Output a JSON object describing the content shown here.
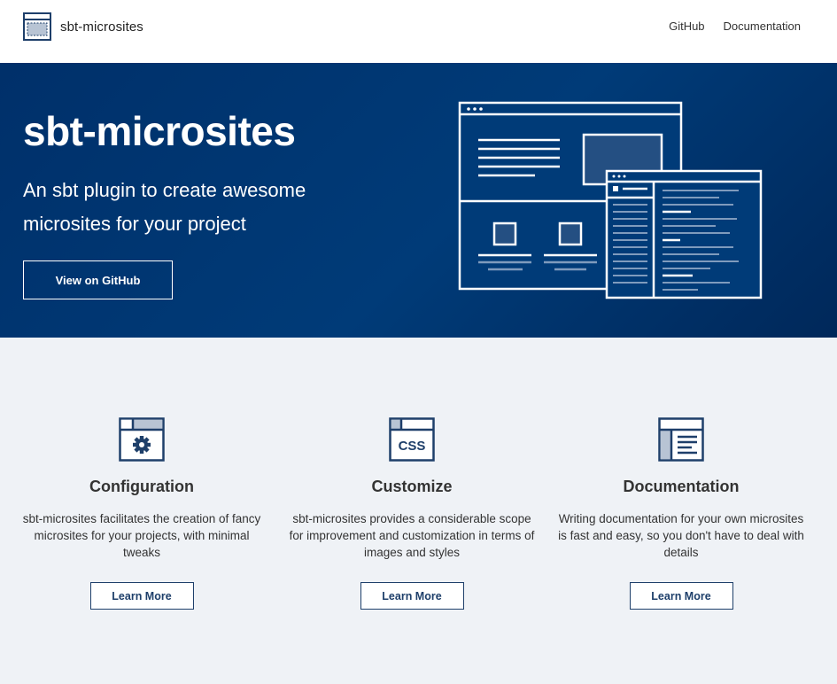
{
  "header": {
    "brand": "sbt-microsites",
    "nav": [
      {
        "label": "GitHub"
      },
      {
        "label": "Documentation"
      }
    ]
  },
  "hero": {
    "title": "sbt-microsites",
    "subtitle": "An sbt plugin to create awesome microsites for your project",
    "button_label": "View on GitHub"
  },
  "features": [
    {
      "icon": "gear-icon",
      "title": "Configuration",
      "description": "sbt-microsites facilitates the creation of fancy microsites for your projects, with minimal tweaks",
      "button_label": "Learn More"
    },
    {
      "icon": "css-icon",
      "title": "Customize",
      "description": "sbt-microsites provides a considerable scope for improvement and customization in terms of images and styles",
      "button_label": "Learn More"
    },
    {
      "icon": "document-icon",
      "title": "Documentation",
      "description": "Writing documentation for your own microsites is fast and easy, so you don't have to deal with details",
      "button_label": "Learn More"
    }
  ],
  "colors": {
    "hero_background": "#003b78",
    "accent": "#1e3f6a",
    "section_background": "#eff2f6",
    "icon_light": "#b8c4d4"
  }
}
